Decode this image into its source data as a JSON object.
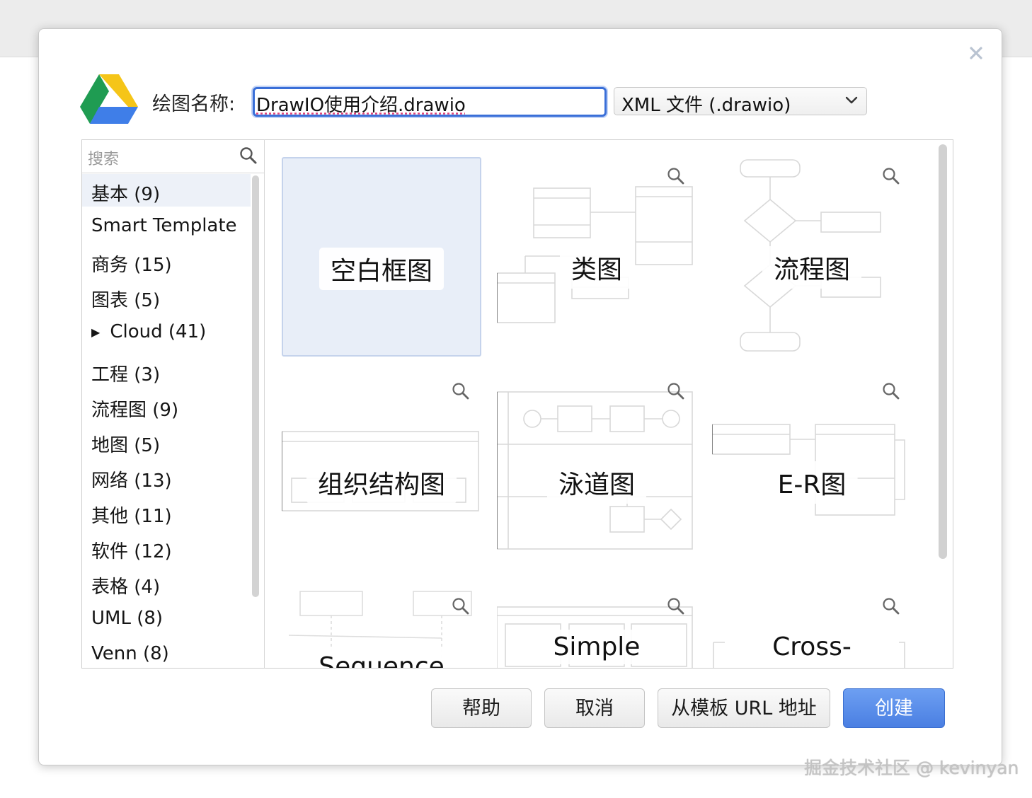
{
  "dialog": {
    "name_label": "绘图名称:",
    "filename": "DrawIO使用介绍.drawio",
    "format": "XML 文件 (.drawio)",
    "search_placeholder": "搜索",
    "categories": [
      {
        "label": "基本 (9)",
        "selected": true
      },
      {
        "label": "Smart Template"
      },
      {
        "label": "商务 (15)"
      },
      {
        "label": "图表 (5)"
      },
      {
        "label": "Cloud (41)",
        "collapsible": true
      },
      {
        "label": "工程 (3)"
      },
      {
        "label": "流程图 (9)"
      },
      {
        "label": "地图 (5)"
      },
      {
        "label": "网络 (13)"
      },
      {
        "label": "其他 (11)"
      },
      {
        "label": "软件 (12)"
      },
      {
        "label": "表格 (4)"
      },
      {
        "label": "UML (8)"
      },
      {
        "label": "Venn (8)"
      }
    ],
    "templates": [
      {
        "label": "空白框图",
        "selected": true
      },
      {
        "label": "类图"
      },
      {
        "label": "流程图"
      },
      {
        "label": "组织结构图"
      },
      {
        "label": "泳道图"
      },
      {
        "label": "E-R图"
      },
      {
        "label": "Sequence"
      },
      {
        "label": "Simple"
      },
      {
        "label": "Cross-"
      }
    ],
    "buttons": {
      "help": "帮助",
      "cancel": "取消",
      "from_url": "从模板 URL 地址",
      "create": "创建"
    },
    "accent_color": "#4a7fe2"
  },
  "watermark": "掘金技术社区 @ kevinyan"
}
